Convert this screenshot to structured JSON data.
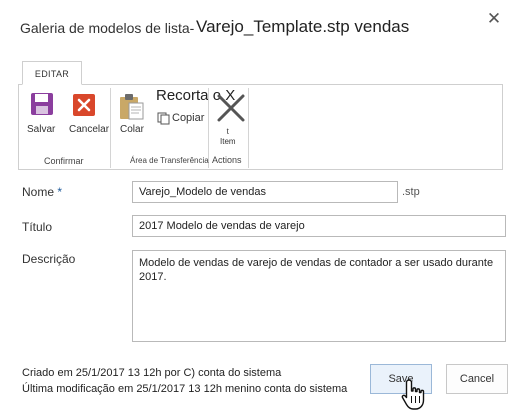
{
  "dialog": {
    "title_prefix": "Galeria de modelos de lista-",
    "title_file": "Varejo_Template.stp vendas",
    "close_icon": "close-icon"
  },
  "ribbon": {
    "tab_label": "EDITAR",
    "buttons": {
      "save": "Salvar",
      "cancel": "Cancelar",
      "paste": "Colar",
      "cut": "Recorta o X",
      "copy": "Copiar",
      "item_line1": "t",
      "item_line2": "Item"
    },
    "groups": {
      "commit": "Confirmar",
      "clipboard": "Área de Transferência",
      "actions": "Actions"
    }
  },
  "form": {
    "name_label": "Nome",
    "name_required": "*",
    "name_value": "Varejo_Modelo de vendas",
    "name_suffix": ".stp",
    "title_label": "Título",
    "title_value": "2017 Modelo de vendas de varejo",
    "description_label": "Descrição",
    "description_value": "Modelo de vendas de varejo de vendas de contador a ser usado durante 2017."
  },
  "footer": {
    "created": "Criado em 25/1/2017 13 12h por C) conta do sistema",
    "modified": "Última modificação em 25/1/2017 13 12h menino conta do sistema",
    "save_button": "Save",
    "cancel_button": "Cancel"
  },
  "colors": {
    "accent": "#1e5a9b",
    "save_icon": "#8b3e9e",
    "cancel_icon": "#d9472b"
  }
}
